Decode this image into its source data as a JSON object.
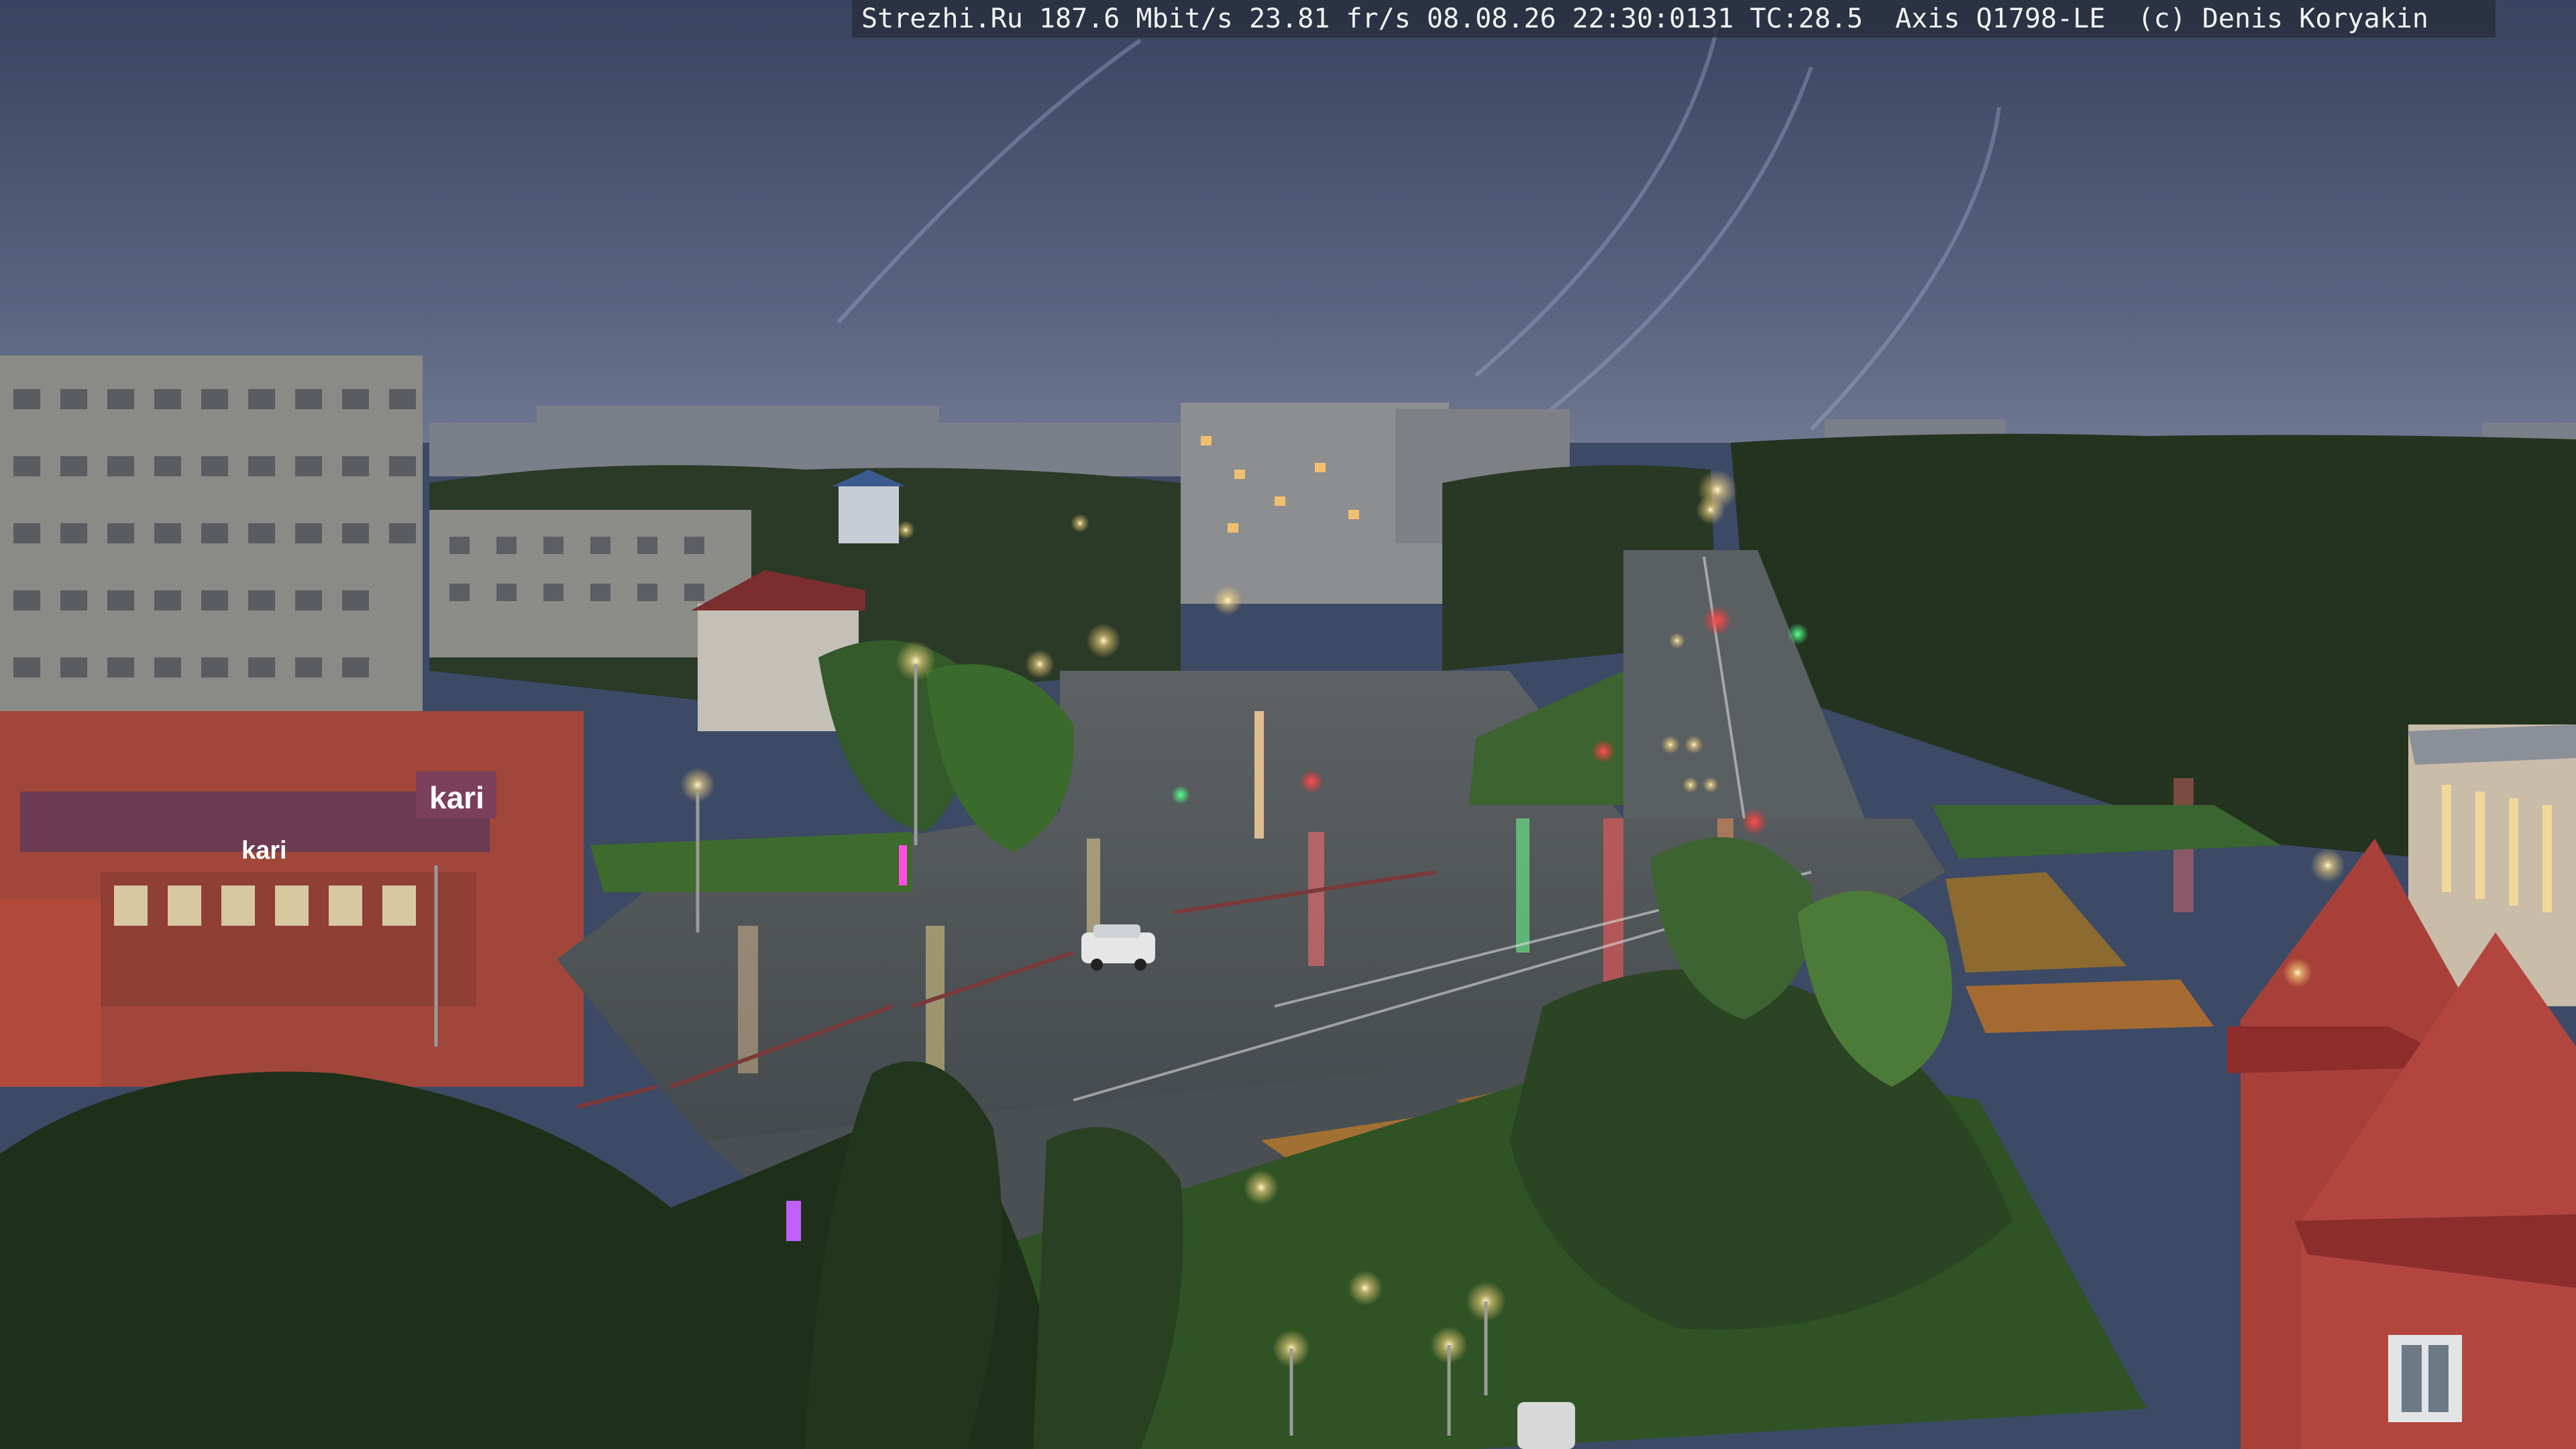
{
  "overlay": {
    "caption": "Strezhi.Ru 187.6 Mbit/s 23.81 fr/s 08.08.26 22:30:0131 TC:28.5  Axis Q1798-LE  (c) Denis Koryakin"
  },
  "signs": {
    "mall_brand": "kari",
    "mall_brand_small": "kari"
  },
  "colors": {
    "sky_top": "#3a4664",
    "sky_horizon": "#67718c",
    "forest": "#23331f",
    "asphalt": "#4a5055",
    "building_gray": "#8a8a86",
    "mall_red": "#a1463a",
    "tower_red": "#a8403a"
  }
}
